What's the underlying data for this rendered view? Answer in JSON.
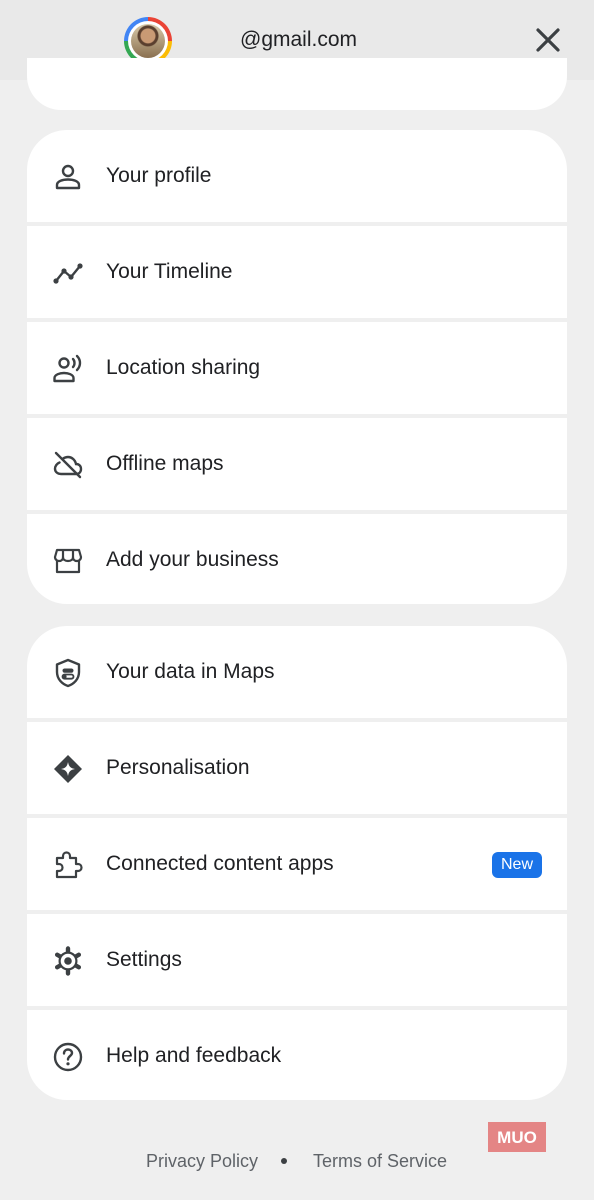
{
  "header": {
    "email": "@gmail.com",
    "close_label": "Close"
  },
  "menu_group_1": [
    {
      "label": "Your profile",
      "icon": "person-icon"
    },
    {
      "label": "Your Timeline",
      "icon": "timeline-icon"
    },
    {
      "label": "Location sharing",
      "icon": "location-sharing-icon"
    },
    {
      "label": "Offline maps",
      "icon": "cloud-off-icon"
    },
    {
      "label": "Add your business",
      "icon": "storefront-icon"
    }
  ],
  "menu_group_2": [
    {
      "label": "Your data in Maps",
      "icon": "shield-toggle-icon"
    },
    {
      "label": "Personalisation",
      "icon": "sparkle-diamond-icon"
    },
    {
      "label": "Connected content apps",
      "icon": "extension-icon",
      "badge": "New"
    },
    {
      "label": "Settings",
      "icon": "gear-icon"
    },
    {
      "label": "Help and feedback",
      "icon": "help-icon"
    }
  ],
  "footer": {
    "privacy": "Privacy Policy",
    "terms": "Terms of Service"
  },
  "watermark": "MUO",
  "colors": {
    "accent": "#1a73e8",
    "background": "#efefef",
    "card": "#ffffff",
    "text": "#202124",
    "muted": "#5f6368",
    "watermark": "#e06666"
  }
}
